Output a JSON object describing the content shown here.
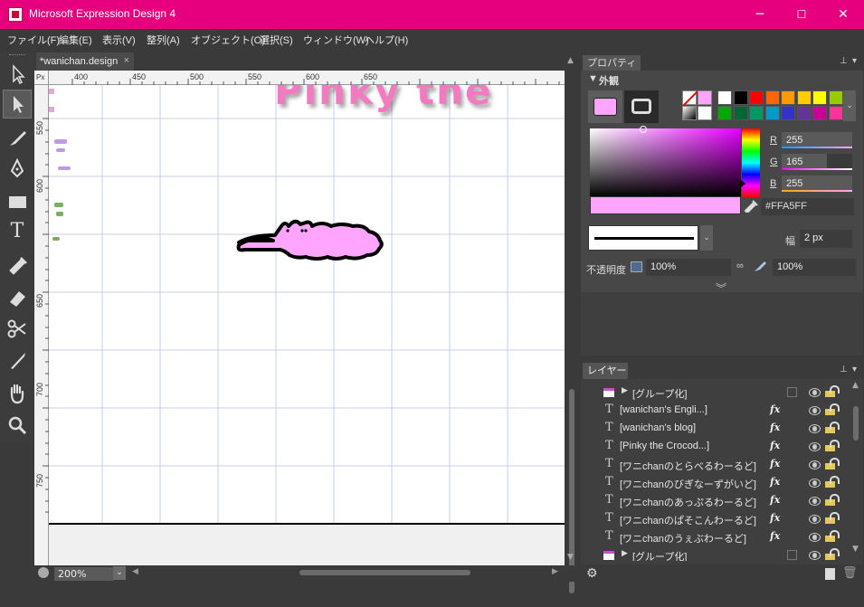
{
  "window": {
    "title": "Microsoft Expression Design 4",
    "minimize": "─",
    "maximize": "☐",
    "close": "✕"
  },
  "menu": [
    "ファイル(F)",
    "編集(E)",
    "表示(V)",
    "整列(A)",
    "オブジェクト(O)",
    "選択(S)",
    "ウィンドウ(W)",
    "ヘルプ(H)"
  ],
  "document": {
    "tab_label": "*wanichan.design",
    "close": "×",
    "ruler_unit": "Px",
    "hruler_labels": [
      "400",
      "450",
      "500",
      "550",
      "600",
      "650"
    ],
    "vruler_labels": [
      "550",
      "600",
      "650",
      "700",
      "750"
    ],
    "canvas_text": "Pinky the",
    "zoom": "200%"
  },
  "properties": {
    "tab_label": "プロパティ(P)",
    "section_label": "外観",
    "r_label": "R",
    "r_value": "255",
    "r_fraction": 1.0,
    "g_label": "G",
    "g_value": "165",
    "g_fraction": 0.647,
    "b_label": "B",
    "b_value": "255",
    "b_fraction": 1.0,
    "hex": "#FFA5FF",
    "width_label": "幅",
    "width_value": "2 px",
    "opacity_label": "不透明度",
    "opacity_value": "100%",
    "opacity_value2": "100%",
    "fill_color": "#FFA5FF",
    "accent": "#e6007e"
  },
  "palette": [
    [
      "#ffffff",
      "#000000",
      "#ff0000",
      "#ff6600",
      "#ff9900",
      "#ffcc00",
      "#ffff00",
      "#99cc00"
    ],
    [
      "#00aa00",
      "#006633",
      "#009966",
      "#0099cc",
      "#3333cc",
      "#663399",
      "#cc0099",
      "#ff3399"
    ]
  ],
  "layers": {
    "tab_label": "レイヤー(L)",
    "items": [
      {
        "kind": "group",
        "label": "[グループ化]",
        "fx": ""
      },
      {
        "kind": "text",
        "label": "[wanichan's Engli...]",
        "fx": "fx"
      },
      {
        "kind": "text",
        "label": "[wanichan's blog]",
        "fx": "fx"
      },
      {
        "kind": "text",
        "label": "[Pinky the Crocod...]",
        "fx": "fx"
      },
      {
        "kind": "text",
        "label": "[ワニchanのとらべるわーるど]",
        "fx": "fx"
      },
      {
        "kind": "text",
        "label": "[ワニchanのびぎなーずがいど]",
        "fx": "fx"
      },
      {
        "kind": "text",
        "label": "[ワニchanのあっぷるわーるど]",
        "fx": "fx"
      },
      {
        "kind": "text",
        "label": "[ワニchanのぱそこんわーるど]",
        "fx": "fx"
      },
      {
        "kind": "text",
        "label": "[ワニchanのうぇぶわーるど]",
        "fx": "fx"
      },
      {
        "kind": "group",
        "label": "[グループ化]",
        "fx": ""
      }
    ]
  }
}
